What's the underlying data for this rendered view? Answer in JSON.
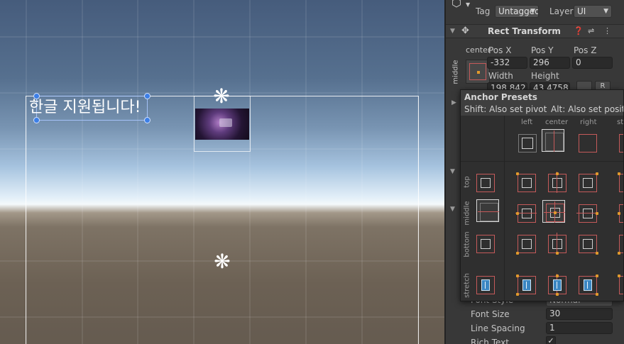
{
  "scene": {
    "sample_text": "한글 지원됩니다!"
  },
  "inspector": {
    "tag_label": "Tag",
    "tag_value": "Untagged",
    "layer_label": "Layer",
    "layer_value": "UI",
    "rect_transform_title": "Rect Transform",
    "anchor_h_label": "center",
    "anchor_v_label": "middle",
    "pos_x_label": "Pos X",
    "pos_y_label": "Pos Y",
    "pos_z_label": "Pos Z",
    "pos_x_value": "-332",
    "pos_y_value": "296",
    "pos_z_value": "0",
    "width_label": "Width",
    "height_label": "Height",
    "width_value": "198.8421",
    "height_value": "43.4758",
    "blueprint_btn": "R",
    "font_style_label": "Font Style",
    "font_style_value": "Normal",
    "font_size_label": "Font Size",
    "font_size_value": "30",
    "line_spacing_label": "Line Spacing",
    "line_spacing_value": "1",
    "rich_text_label": "Rich Text",
    "rich_text_checked": "✓"
  },
  "anchor_presets": {
    "title": "Anchor Presets",
    "shift_hint": "Shift: Also set pivot",
    "alt_hint": "Alt: Also set position",
    "columns": [
      "left",
      "center",
      "right",
      "stretch"
    ],
    "rows": [
      "top",
      "middle",
      "bottom",
      "stretch"
    ]
  },
  "colors": {
    "accent_handle": "#3d7fe6",
    "anchor_red": "#c55a5a",
    "anchor_orange": "#e29a2c",
    "stretch_blue": "#3a86c2"
  }
}
